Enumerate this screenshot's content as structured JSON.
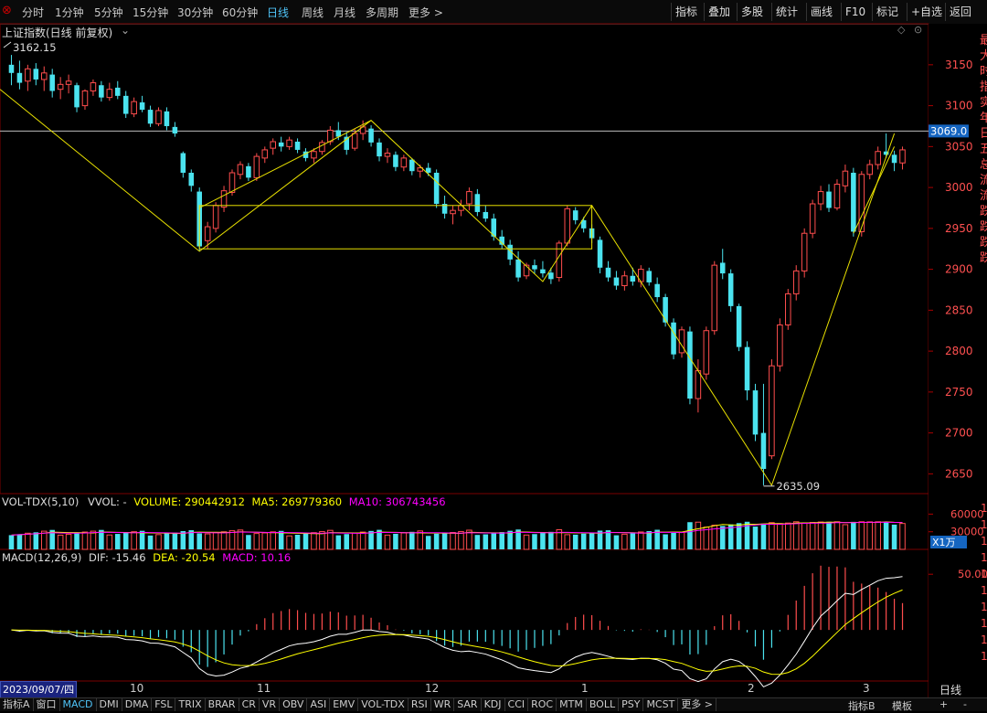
{
  "toolbar": {
    "left_tabs": [
      "分时",
      "1分钟",
      "5分钟",
      "15分钟",
      "30分钟",
      "60分钟",
      "日线",
      "周线",
      "月线",
      "多周期",
      "更多 >"
    ],
    "active_tab": "日线",
    "right_buttons": [
      "指标",
      "叠加",
      "多股",
      "统计",
      "画线",
      "F10",
      "标记",
      "+自选",
      "返回"
    ]
  },
  "title": {
    "name": "上证指数(日线 前复权)",
    "high_label": "3162.15",
    "low_label": "2635.09"
  },
  "volume_panel": {
    "label": "VOL-TDX(5,10)",
    "vvol": "VVOL: -",
    "volume": "VOLUME: 290442912",
    "ma5": "MA5: 269779360",
    "ma10": "MA10: 306743456",
    "unit": "X1万"
  },
  "macd_panel": {
    "label": "MACD(12,26,9)",
    "dif": "DIF: -15.46",
    "dea": "DEA: -20.54",
    "macd": "MACD: 10.16"
  },
  "date_axis": {
    "cursor_date": "2023/09/07/四",
    "ticks": [
      "10",
      "11",
      "12",
      "1",
      "2",
      "3"
    ]
  },
  "right_side": {
    "period_label": "日线",
    "plus": "+",
    "minus": "-"
  },
  "bottom_tabs": [
    "指标A",
    "窗口",
    "MACD",
    "DMI",
    "DMA",
    "FSL",
    "TRIX",
    "BRAR",
    "CR",
    "VR",
    "OBV",
    "ASI",
    "EMV",
    "VOL-TDX",
    "RSI",
    "WR",
    "SAR",
    "KDJ",
    "CCI",
    "ROC",
    "MTM",
    "BOLL",
    "PSY",
    "MCST",
    "更多 >",
    "指标B",
    "模板"
  ],
  "bottom_active": "MACD",
  "colors": {
    "up": "#ff4d4d",
    "down": "#4be3ef",
    "ma5": "#ffff00",
    "ma10": "#ff00ff",
    "dif": "#ffffff",
    "dea": "#ffff00",
    "crosshair_price_bg": "#1565c0",
    "trendline": "#e8e000"
  },
  "chart_data": [
    {
      "type": "candlestick",
      "title": "上证指数(日线 前复权)",
      "y_axis_ticks": [
        3150,
        3100,
        3050,
        3000,
        2950,
        2900,
        2850,
        2800,
        2750,
        2700,
        2650
      ],
      "ylim": [
        2618,
        3180
      ],
      "crosshair_price": "3069.0",
      "high_marker": 3162.15,
      "low_marker": 2635.09,
      "candles": [
        [
          3150,
          3162,
          3125,
          3140
        ],
        [
          3140,
          3155,
          3120,
          3128
        ],
        [
          3130,
          3150,
          3118,
          3145
        ],
        [
          3145,
          3152,
          3125,
          3132
        ],
        [
          3132,
          3148,
          3118,
          3140
        ],
        [
          3138,
          3145,
          3110,
          3118
        ],
        [
          3120,
          3135,
          3108,
          3126
        ],
        [
          3126,
          3138,
          3115,
          3130
        ],
        [
          3125,
          3128,
          3092,
          3098
        ],
        [
          3100,
          3120,
          3095,
          3118
        ],
        [
          3118,
          3132,
          3112,
          3128
        ],
        [
          3125,
          3130,
          3105,
          3110
        ],
        [
          3110,
          3128,
          3106,
          3120
        ],
        [
          3122,
          3130,
          3108,
          3112
        ],
        [
          3112,
          3118,
          3085,
          3090
        ],
        [
          3090,
          3110,
          3086,
          3105
        ],
        [
          3104,
          3112,
          3092,
          3095
        ],
        [
          3095,
          3100,
          3074,
          3078
        ],
        [
          3078,
          3098,
          3075,
          3094
        ],
        [
          3093,
          3098,
          3070,
          3075
        ],
        [
          3074,
          3080,
          3062,
          3066
        ],
        [
          3042,
          3044,
          3012,
          3018
        ],
        [
          3018,
          3022,
          2995,
          3002
        ],
        [
          2995,
          3000,
          2922,
          2928
        ],
        [
          2935,
          2958,
          2925,
          2952
        ],
        [
          2950,
          2982,
          2945,
          2978
        ],
        [
          2976,
          3002,
          2970,
          2996
        ],
        [
          2994,
          3022,
          2990,
          3018
        ],
        [
          3016,
          3032,
          3010,
          3028
        ],
        [
          3026,
          3030,
          3008,
          3012
        ],
        [
          3012,
          3042,
          3008,
          3038
        ],
        [
          3036,
          3050,
          3030,
          3046
        ],
        [
          3048,
          3060,
          3040,
          3056
        ],
        [
          3055,
          3062,
          3044,
          3050
        ],
        [
          3050,
          3062,
          3046,
          3058
        ],
        [
          3056,
          3060,
          3042,
          3046
        ],
        [
          3044,
          3048,
          3032,
          3036
        ],
        [
          3036,
          3048,
          3030,
          3044
        ],
        [
          3044,
          3058,
          3040,
          3055
        ],
        [
          3056,
          3075,
          3052,
          3070
        ],
        [
          3070,
          3080,
          3058,
          3062
        ],
        [
          3062,
          3068,
          3040,
          3046
        ],
        [
          3048,
          3072,
          3045,
          3066
        ],
        [
          3066,
          3082,
          3058,
          3074
        ],
        [
          3072,
          3076,
          3050,
          3055
        ],
        [
          3055,
          3060,
          3032,
          3038
        ],
        [
          3038,
          3048,
          3030,
          3042
        ],
        [
          3040,
          3044,
          3020,
          3025
        ],
        [
          3025,
          3040,
          3020,
          3036
        ],
        [
          3034,
          3036,
          3015,
          3020
        ],
        [
          3020,
          3028,
          3012,
          3024
        ],
        [
          3024,
          3030,
          3014,
          3018
        ],
        [
          3018,
          3022,
          2975,
          2980
        ],
        [
          2980,
          2990,
          2962,
          2968
        ],
        [
          2968,
          2978,
          2955,
          2972
        ],
        [
          2972,
          2985,
          2965,
          2978
        ],
        [
          2980,
          3000,
          2972,
          2995
        ],
        [
          2992,
          2998,
          2965,
          2970
        ],
        [
          2970,
          2978,
          2958,
          2962
        ],
        [
          2962,
          2968,
          2935,
          2940
        ],
        [
          2940,
          2948,
          2925,
          2930
        ],
        [
          2930,
          2936,
          2905,
          2912
        ],
        [
          2912,
          2922,
          2885,
          2890
        ],
        [
          2892,
          2908,
          2888,
          2905
        ],
        [
          2905,
          2912,
          2895,
          2900
        ],
        [
          2900,
          2910,
          2890,
          2895
        ],
        [
          2896,
          2902,
          2882,
          2888
        ],
        [
          2890,
          2935,
          2885,
          2932
        ],
        [
          2932,
          2978,
          2928,
          2974
        ],
        [
          2972,
          2976,
          2955,
          2960
        ],
        [
          2960,
          2964,
          2945,
          2950
        ],
        [
          2950,
          2955,
          2932,
          2938
        ],
        [
          2936,
          2940,
          2895,
          2902
        ],
        [
          2902,
          2910,
          2885,
          2890
        ],
        [
          2890,
          2898,
          2875,
          2880
        ],
        [
          2880,
          2898,
          2874,
          2892
        ],
        [
          2892,
          2902,
          2880,
          2885
        ],
        [
          2885,
          2905,
          2878,
          2900
        ],
        [
          2898,
          2902,
          2880,
          2884
        ],
        [
          2882,
          2890,
          2860,
          2866
        ],
        [
          2866,
          2870,
          2830,
          2835
        ],
        [
          2835,
          2840,
          2790,
          2796
        ],
        [
          2798,
          2830,
          2792,
          2826
        ],
        [
          2824,
          2830,
          2735,
          2742
        ],
        [
          2742,
          2790,
          2725,
          2776
        ],
        [
          2772,
          2830,
          2765,
          2825
        ],
        [
          2825,
          2910,
          2820,
          2905
        ],
        [
          2908,
          2925,
          2888,
          2895
        ],
        [
          2895,
          2900,
          2848,
          2855
        ],
        [
          2855,
          2858,
          2800,
          2805
        ],
        [
          2805,
          2812,
          2740,
          2752
        ],
        [
          2752,
          2760,
          2690,
          2698
        ],
        [
          2700,
          2760,
          2636,
          2656
        ],
        [
          2672,
          2790,
          2668,
          2782
        ],
        [
          2782,
          2840,
          2775,
          2832
        ],
        [
          2832,
          2876,
          2826,
          2870
        ],
        [
          2870,
          2905,
          2862,
          2898
        ],
        [
          2898,
          2950,
          2890,
          2944
        ],
        [
          2944,
          2985,
          2938,
          2980
        ],
        [
          2980,
          3002,
          2972,
          2995
        ],
        [
          2995,
          3004,
          2970,
          2975
        ],
        [
          2975,
          3010,
          2972,
          3004
        ],
        [
          3002,
          3028,
          2994,
          3020
        ],
        [
          3018,
          3024,
          2940,
          2946
        ],
        [
          2946,
          3020,
          2940,
          3016
        ],
        [
          3016,
          3034,
          3010,
          3028
        ],
        [
          3028,
          3050,
          3022,
          3044
        ],
        [
          3044,
          3066,
          3036,
          3040
        ],
        [
          3040,
          3045,
          3020,
          3030
        ],
        [
          3030,
          3050,
          3022,
          3046
        ]
      ],
      "zigzag": [
        [
          0,
          3120
        ],
        [
          23,
          2922
        ],
        [
          44,
          3082
        ],
        [
          65,
          2885
        ],
        [
          71,
          2978
        ],
        [
          93,
          2636
        ],
        [
          108,
          3066
        ]
      ],
      "box1": [
        23,
        71,
        2925,
        2978
      ]
    },
    {
      "type": "bar",
      "title": "VOL-TDX(5,10)",
      "y_axis_ticks": [
        60000,
        30000
      ],
      "unit": "X1万"
    },
    {
      "type": "bar",
      "title": "MACD(12,26,9)",
      "y_axis_ticks": [
        50
      ],
      "series": [
        {
          "name": "DIF",
          "value": -15.46
        },
        {
          "name": "DEA",
          "value": -20.54
        },
        {
          "name": "MACD",
          "value": 10.16
        }
      ]
    }
  ]
}
